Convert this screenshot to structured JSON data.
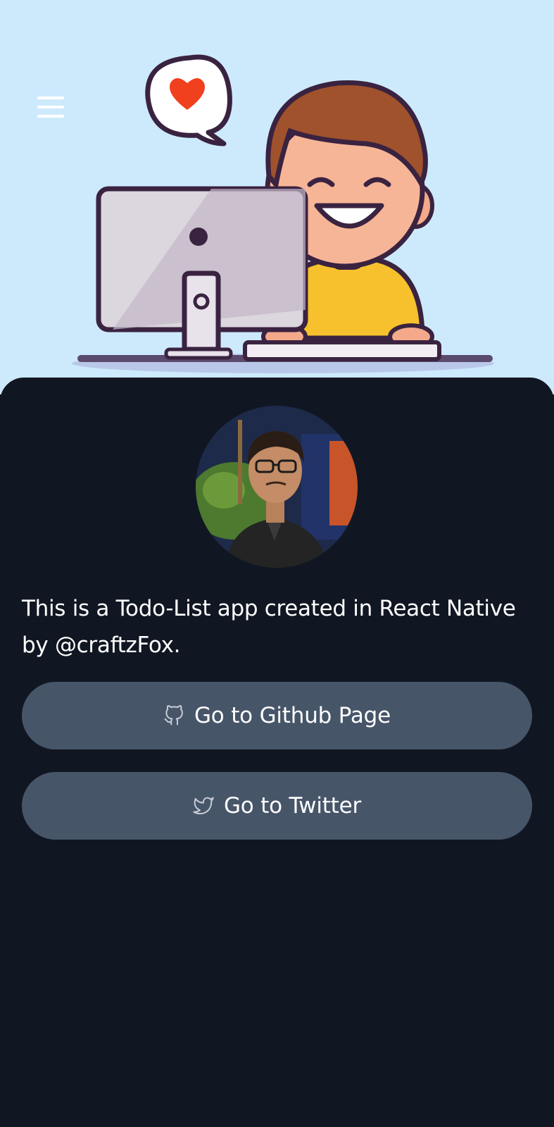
{
  "header": {
    "menu_icon": "hamburger-menu-icon",
    "illustration": "boy-at-computer-illustration",
    "colors": {
      "background": "#cdeafd",
      "heart": "#f0401e",
      "shirt": "#f6c12c",
      "hair": "#a0522d"
    }
  },
  "about": {
    "description": "This is a Todo-List app created in React Native by @craftzFox.",
    "github_button": {
      "label": "Go to Github Page",
      "icon": "github-icon"
    },
    "twitter_button": {
      "label": "Go to Twitter",
      "icon": "twitter-icon"
    },
    "colors": {
      "panel": "#111722",
      "button": "#475569",
      "text": "#ffffff"
    }
  }
}
